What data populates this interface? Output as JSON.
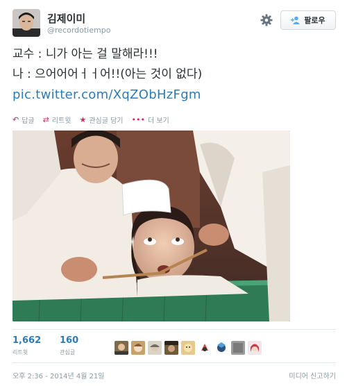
{
  "user": {
    "name": "김제이미",
    "handle": "@recordotiempo"
  },
  "follow_button": {
    "label": "팔로우",
    "icon": "follow-person-icon"
  },
  "settings_icon": "gear-icon",
  "tweet": {
    "line1": "교수 : 니가 아는 걸 말해라!!!",
    "line2": "나 : 으어어어ㅓㅓ어!!(아는 것이 없다)",
    "link": "pic.twitter.com/XqZObHzFgm"
  },
  "actions": [
    {
      "label": "답글",
      "icon": "reply-icon"
    },
    {
      "label": "리트윗",
      "icon": "retweet-icon"
    },
    {
      "label": "관심글 담기",
      "icon": "star-icon"
    },
    {
      "label": "더 보기",
      "icon": "more-icon"
    }
  ],
  "stats": {
    "retweets": {
      "count": "1,662",
      "label": "리트윗"
    },
    "favorites": {
      "count": "160",
      "label": "관심글"
    }
  },
  "footer": {
    "timestamp": "오후 2:36 - 2014년 4월 21일",
    "report": "미디어 신고하기"
  },
  "colors": {
    "link": "#2b7bb9",
    "muted": "#8899a6",
    "accent": "#e0245e"
  }
}
